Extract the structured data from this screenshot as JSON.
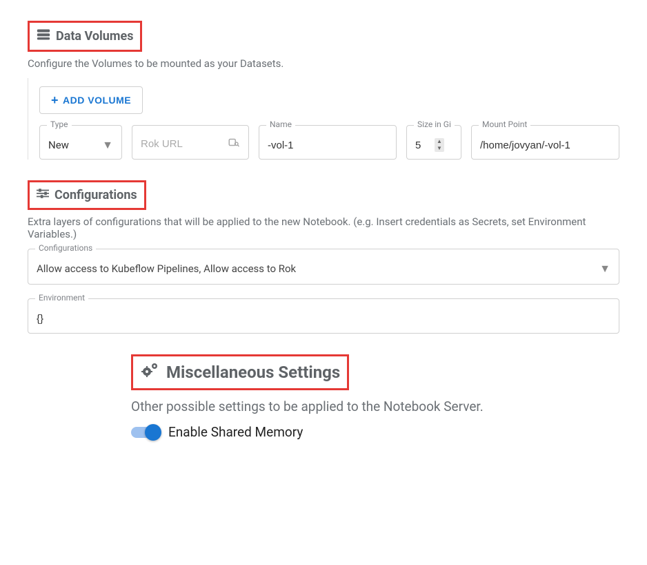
{
  "dataVolumes": {
    "title": "Data Volumes",
    "description": "Configure the Volumes to be mounted as your Datasets.",
    "addButton": "ADD VOLUME",
    "fields": {
      "typeLabel": "Type",
      "typeValue": "New",
      "rokPlaceholder": "Rok URL",
      "nameLabel": "Name",
      "nameValue": "-vol-1",
      "sizeLabel": "Size in Gi",
      "sizeValue": "5",
      "mountLabel": "Mount Point",
      "mountValue": "/home/jovyan/-vol-1"
    }
  },
  "configurations": {
    "title": "Configurations",
    "description": "Extra layers of configurations that will be applied to the new Notebook. (e.g. Insert credentials as Secrets, set Environment Variables.)",
    "selectLabel": "Configurations",
    "selectValue": "Allow access to Kubeflow Pipelines, Allow access to Rok",
    "envLabel": "Environment",
    "envValue": "{}"
  },
  "misc": {
    "title": "Miscellaneous Settings",
    "description": "Other possible settings to be applied to the Notebook Server.",
    "toggleLabel": "Enable Shared Memory",
    "toggleOn": true
  }
}
